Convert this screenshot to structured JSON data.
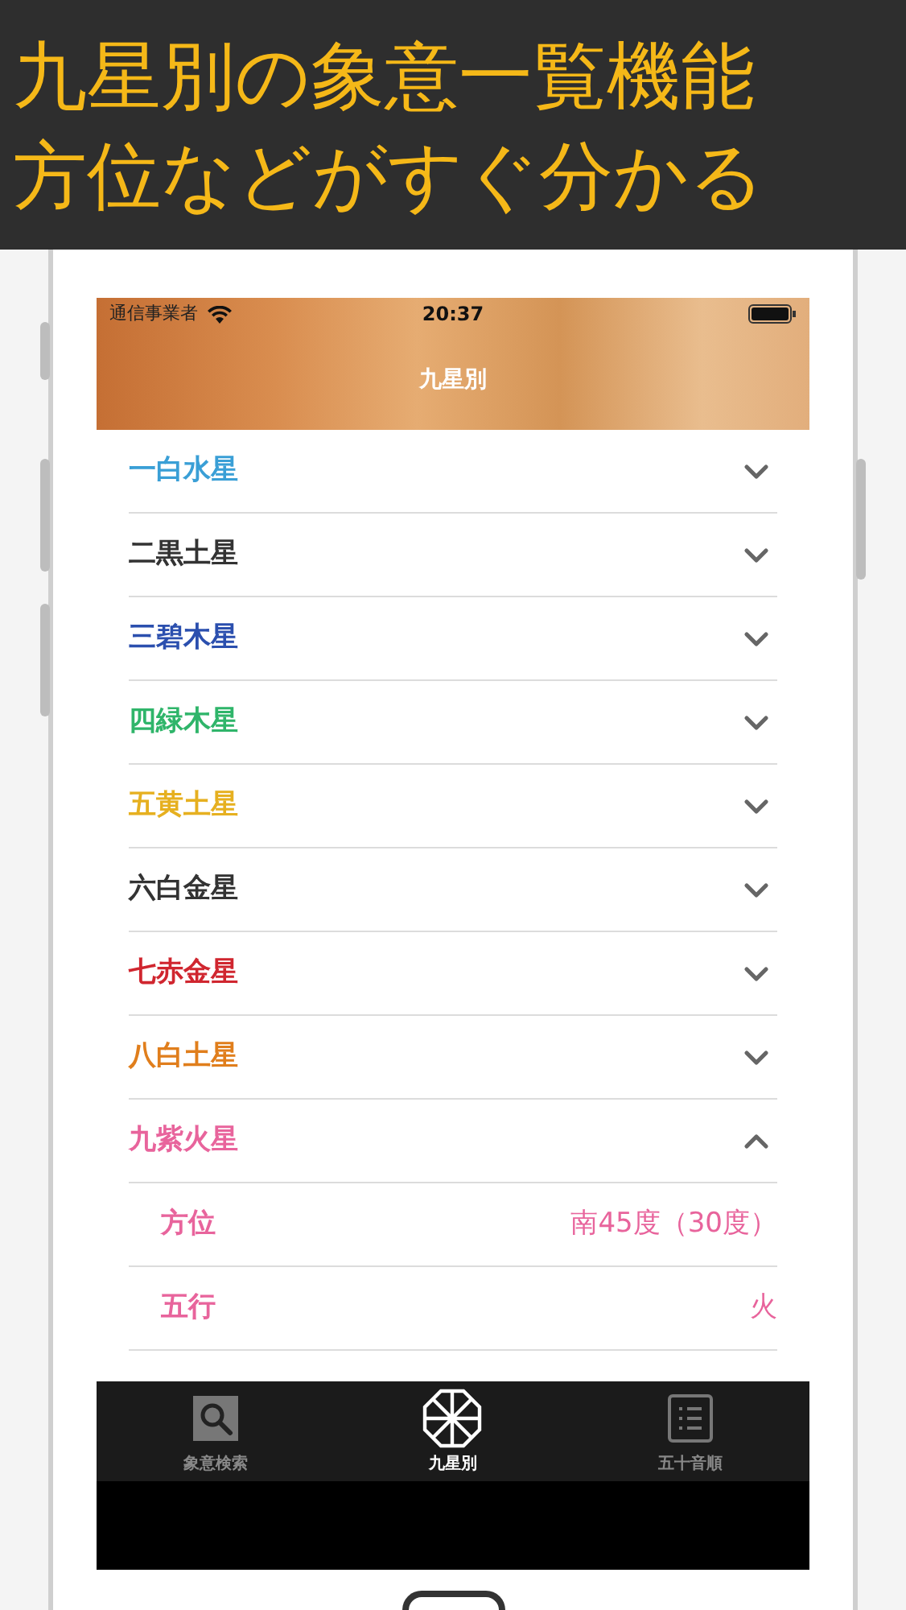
{
  "banner": {
    "lines": [
      "九星別の象意一覧機能",
      "方位などがすぐ分かる"
    ]
  },
  "status_bar": {
    "carrier": "通信事業者",
    "time": "20:37"
  },
  "nav": {
    "title": "九星別"
  },
  "stars": [
    {
      "name": "一白水星",
      "color": "#3a9fd6",
      "expanded": false
    },
    {
      "name": "二黒土星",
      "color": "#333333",
      "expanded": false
    },
    {
      "name": "三碧木星",
      "color": "#2b4fae",
      "expanded": false
    },
    {
      "name": "四緑木星",
      "color": "#2fb56a",
      "expanded": false
    },
    {
      "name": "五黄土星",
      "color": "#e6b020",
      "expanded": false
    },
    {
      "name": "六白金星",
      "color": "#333333",
      "expanded": false
    },
    {
      "name": "七赤金星",
      "color": "#d0262f",
      "expanded": false
    },
    {
      "name": "八白土星",
      "color": "#e07e1c",
      "expanded": false
    },
    {
      "name": "九紫火星",
      "color": "#e8649c",
      "expanded": true,
      "details": [
        {
          "label": "方位",
          "value": "南45度（30度）"
        },
        {
          "label": "五行",
          "value": "火"
        }
      ]
    }
  ],
  "tabs": [
    {
      "label": "象意検索",
      "kind": "search",
      "selected": false
    },
    {
      "label": "九星別",
      "kind": "wheel",
      "selected": true
    },
    {
      "label": "五十音順",
      "kind": "list",
      "selected": false
    }
  ]
}
